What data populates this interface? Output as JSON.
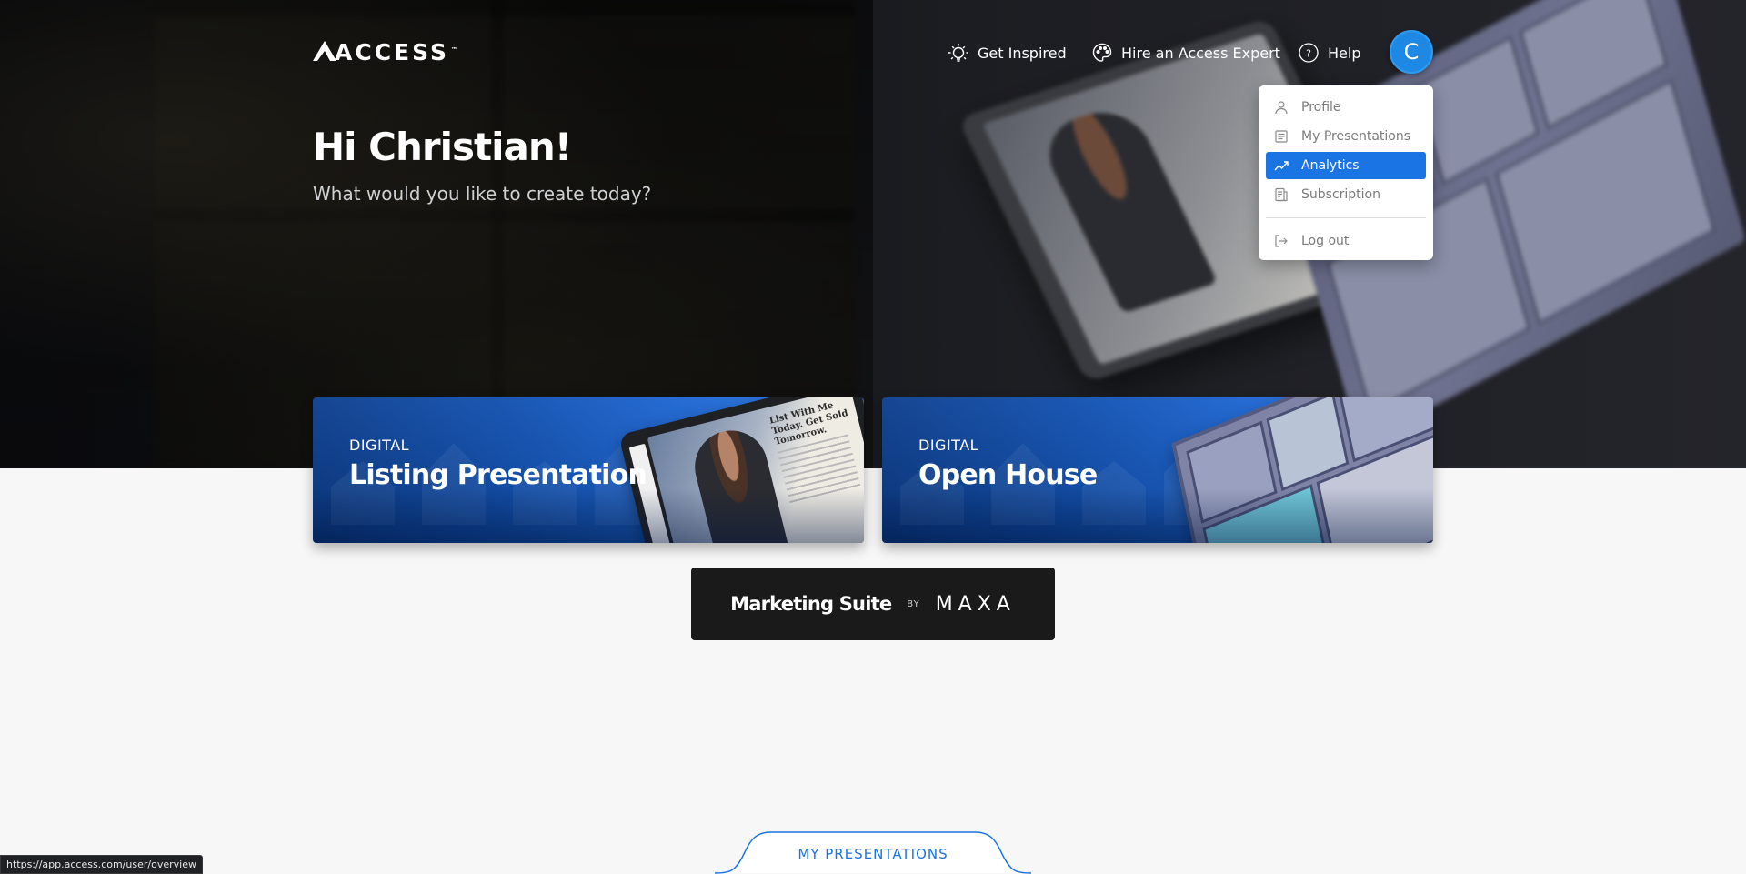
{
  "brand": {
    "logo_text": "ACCESS",
    "logo_tm": "™"
  },
  "nav": {
    "get_inspired": "Get Inspired",
    "hire_expert": "Hire an Access Expert",
    "help": "Help"
  },
  "user": {
    "avatar_initial": "C"
  },
  "menu": {
    "profile": "Profile",
    "my_presentations": "My Presentations",
    "analytics": "Analytics",
    "subscription": "Subscription",
    "log_out": "Log out"
  },
  "hero": {
    "title": "Hi Christian!",
    "subtitle": "What would you like to create today?"
  },
  "cards": {
    "listing": {
      "kicker": "DIGITAL",
      "title": "Listing Presentation",
      "tablet_copy": "List With Me Today. Get Sold Tomorrow."
    },
    "open_house": {
      "kicker": "DIGITAL",
      "title": "Open House"
    }
  },
  "marketing": {
    "title": "Marketing Suite",
    "by": "BY",
    "brand": "MAXA"
  },
  "section_tab": {
    "label": "MY PRESENTATIONS"
  },
  "status": {
    "url": "https://app.access.com/user/overview"
  },
  "colors": {
    "accent": "#1b74e4",
    "avatar": "#1e88e5",
    "dark_panel": "#1a1a1a"
  }
}
